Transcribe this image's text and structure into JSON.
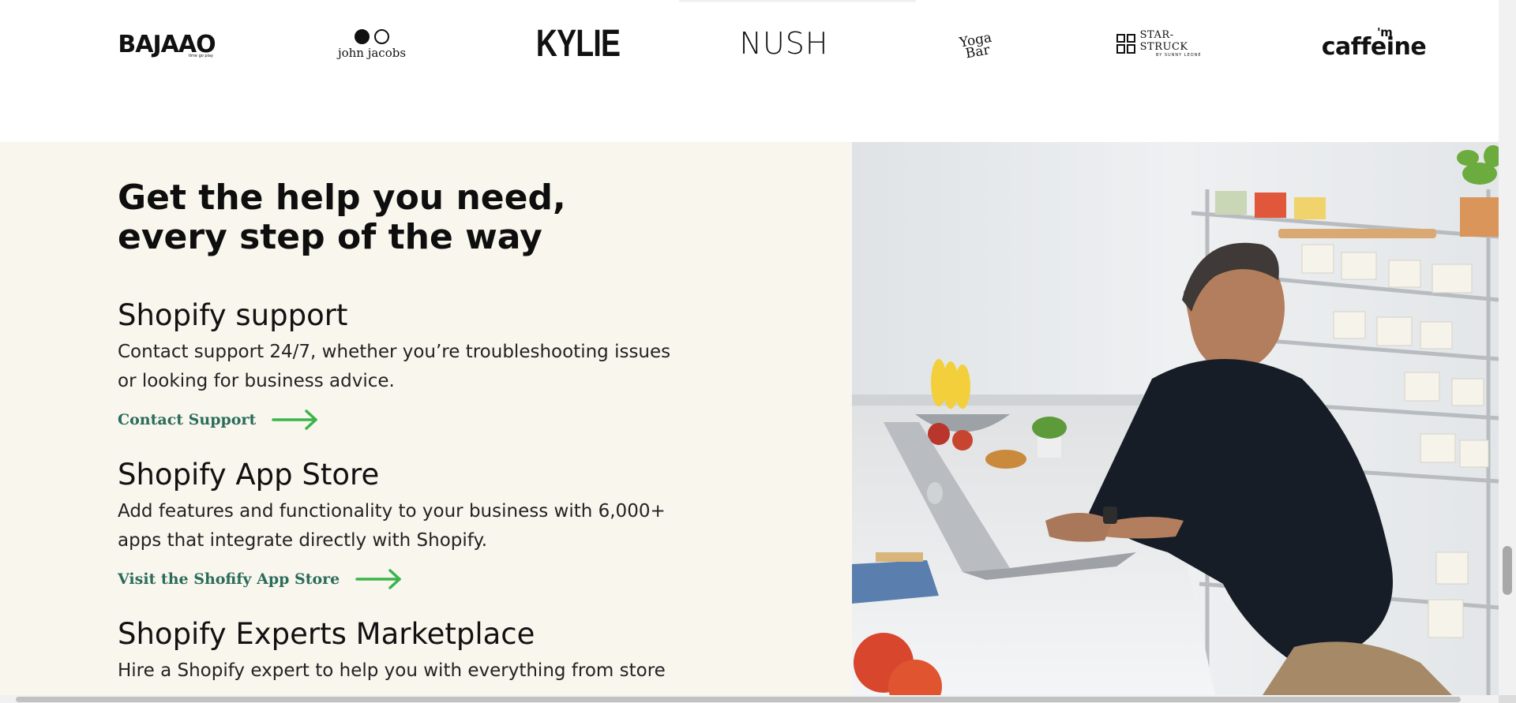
{
  "logos": {
    "bajaao": "BAJAAO",
    "bajaao_tag": "time go play",
    "john_jacobs": "john jacobs",
    "kylie": "KYLIE",
    "nush": "NUSH",
    "yoga_bar_line1": "Yoga",
    "yoga_bar_line2": "Bar",
    "star_struck": "STAR-STRUCK",
    "star_struck_sub": "BY SUNNY LEONE",
    "mcaffeine": "caffeine",
    "mcaffeine_m": "'m"
  },
  "help": {
    "heading_line1": "Get the help you need,",
    "heading_line2": "every step of the way",
    "items": [
      {
        "title": "Shopify support",
        "description": "Contact support 24/7, whether you’re troubleshooting issues or looking for business advice.",
        "link": "Contact Support"
      },
      {
        "title": "Shopify App Store",
        "description": "Add features and functionality to your business with 6,000+ apps that integrate directly with Shopify.",
        "link": "Visit the Shofify App Store"
      },
      {
        "title": "Shopify Experts Marketplace",
        "description": "Hire a Shopify expert to help you with everything from store"
      }
    ]
  },
  "colors": {
    "section_bg": "#f9f6ee",
    "link": "#2a6c5a",
    "arrow": "#3ab44a"
  },
  "scrollbar": {
    "vertical_position": 0.86
  }
}
